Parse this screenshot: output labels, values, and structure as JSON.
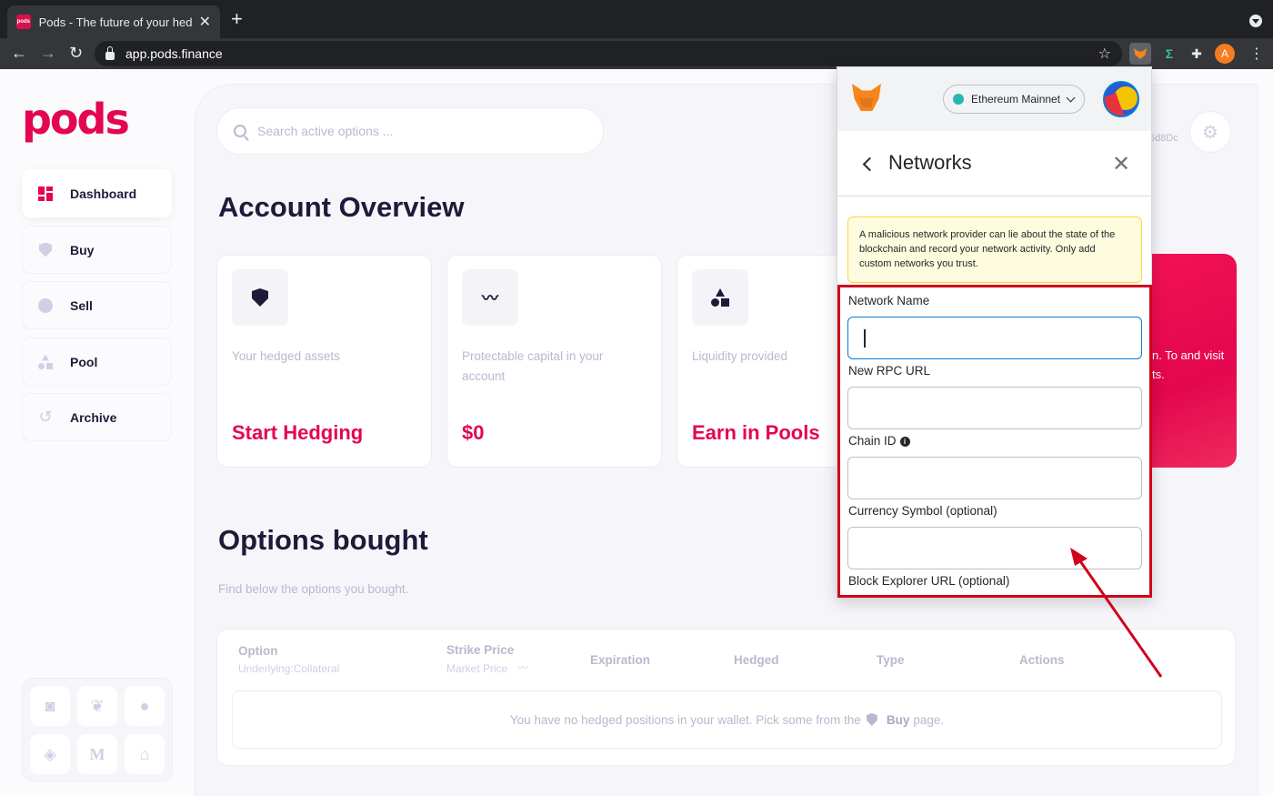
{
  "browser": {
    "tab_favicon": "pods",
    "tab_title": "Pods - The future of your hedging",
    "tab_close": "✕",
    "new_tab": "+",
    "url": "app.pods.finance",
    "profile_initial": "A",
    "icons": [
      "back-arrow-icon",
      "forward-arrow-icon",
      "reload-icon",
      "lock-icon",
      "star-icon",
      "metamask-icon",
      "sigma-icon",
      "puzzle-icon",
      "kebab-menu-icon"
    ]
  },
  "app": {
    "logo": "pods",
    "accent_color": "#e4064f",
    "sidebar": [
      {
        "label": "Dashboard",
        "icon": "dashboard-grid-icon",
        "active": true
      },
      {
        "label": "Buy",
        "icon": "shield-icon",
        "active": false
      },
      {
        "label": "Sell",
        "icon": "coin-icon",
        "active": false
      },
      {
        "label": "Pool",
        "icon": "shapes-icon",
        "active": false
      },
      {
        "label": "Archive",
        "icon": "history-icon",
        "active": false
      }
    ],
    "socials": [
      "discord-icon",
      "twitter-icon",
      "github-icon",
      "docs-icon",
      "medium-icon",
      "governance-icon"
    ],
    "search": {
      "placeholder": "Search active options ..."
    },
    "address_fragment": "6d8Dc",
    "account_overview_title": "Account Overview",
    "cards": [
      {
        "label": "Your hedged assets",
        "value": "Start Hedging",
        "icon": "shield-icon"
      },
      {
        "label": "Protectable capital in your account",
        "value": "$0",
        "icon": "trend-icon"
      },
      {
        "label": "Liquidity provided",
        "value": "Earn in Pools",
        "icon": "shapes-icon"
      }
    ],
    "promo_text": "n. To and visit ts.",
    "options_title": "Options bought",
    "options_subtitle": "Find below the options you bought.",
    "table": {
      "columns": [
        {
          "label": "Option",
          "sub": "Underlying:Collateral"
        },
        {
          "label": "Strike Price",
          "sub": "Market Price"
        },
        {
          "label": "Expiration",
          "sub": ""
        },
        {
          "label": "Hedged",
          "sub": ""
        },
        {
          "label": "Type",
          "sub": ""
        },
        {
          "label": "Actions",
          "sub": ""
        }
      ],
      "empty_message": "You have no hedged positions in your wallet. Pick some from the",
      "empty_link": "Buy",
      "empty_suffix": "page."
    }
  },
  "metamask": {
    "network": "Ethereum Mainnet",
    "network_color": "#29b6af",
    "title": "Networks",
    "close": "✕",
    "warning": "A malicious network provider can lie about the state of the blockchain and record your network activity. Only add custom networks you trust.",
    "fields": [
      {
        "label": "Network Name",
        "value": ""
      },
      {
        "label": "New RPC URL",
        "value": ""
      },
      {
        "label": "Chain ID",
        "value": "",
        "info": "i"
      },
      {
        "label": "Currency Symbol (optional)",
        "value": ""
      }
    ],
    "last_label": "Block Explorer URL (optional)"
  },
  "annotation": {
    "highlight_color": "#d0021b"
  }
}
